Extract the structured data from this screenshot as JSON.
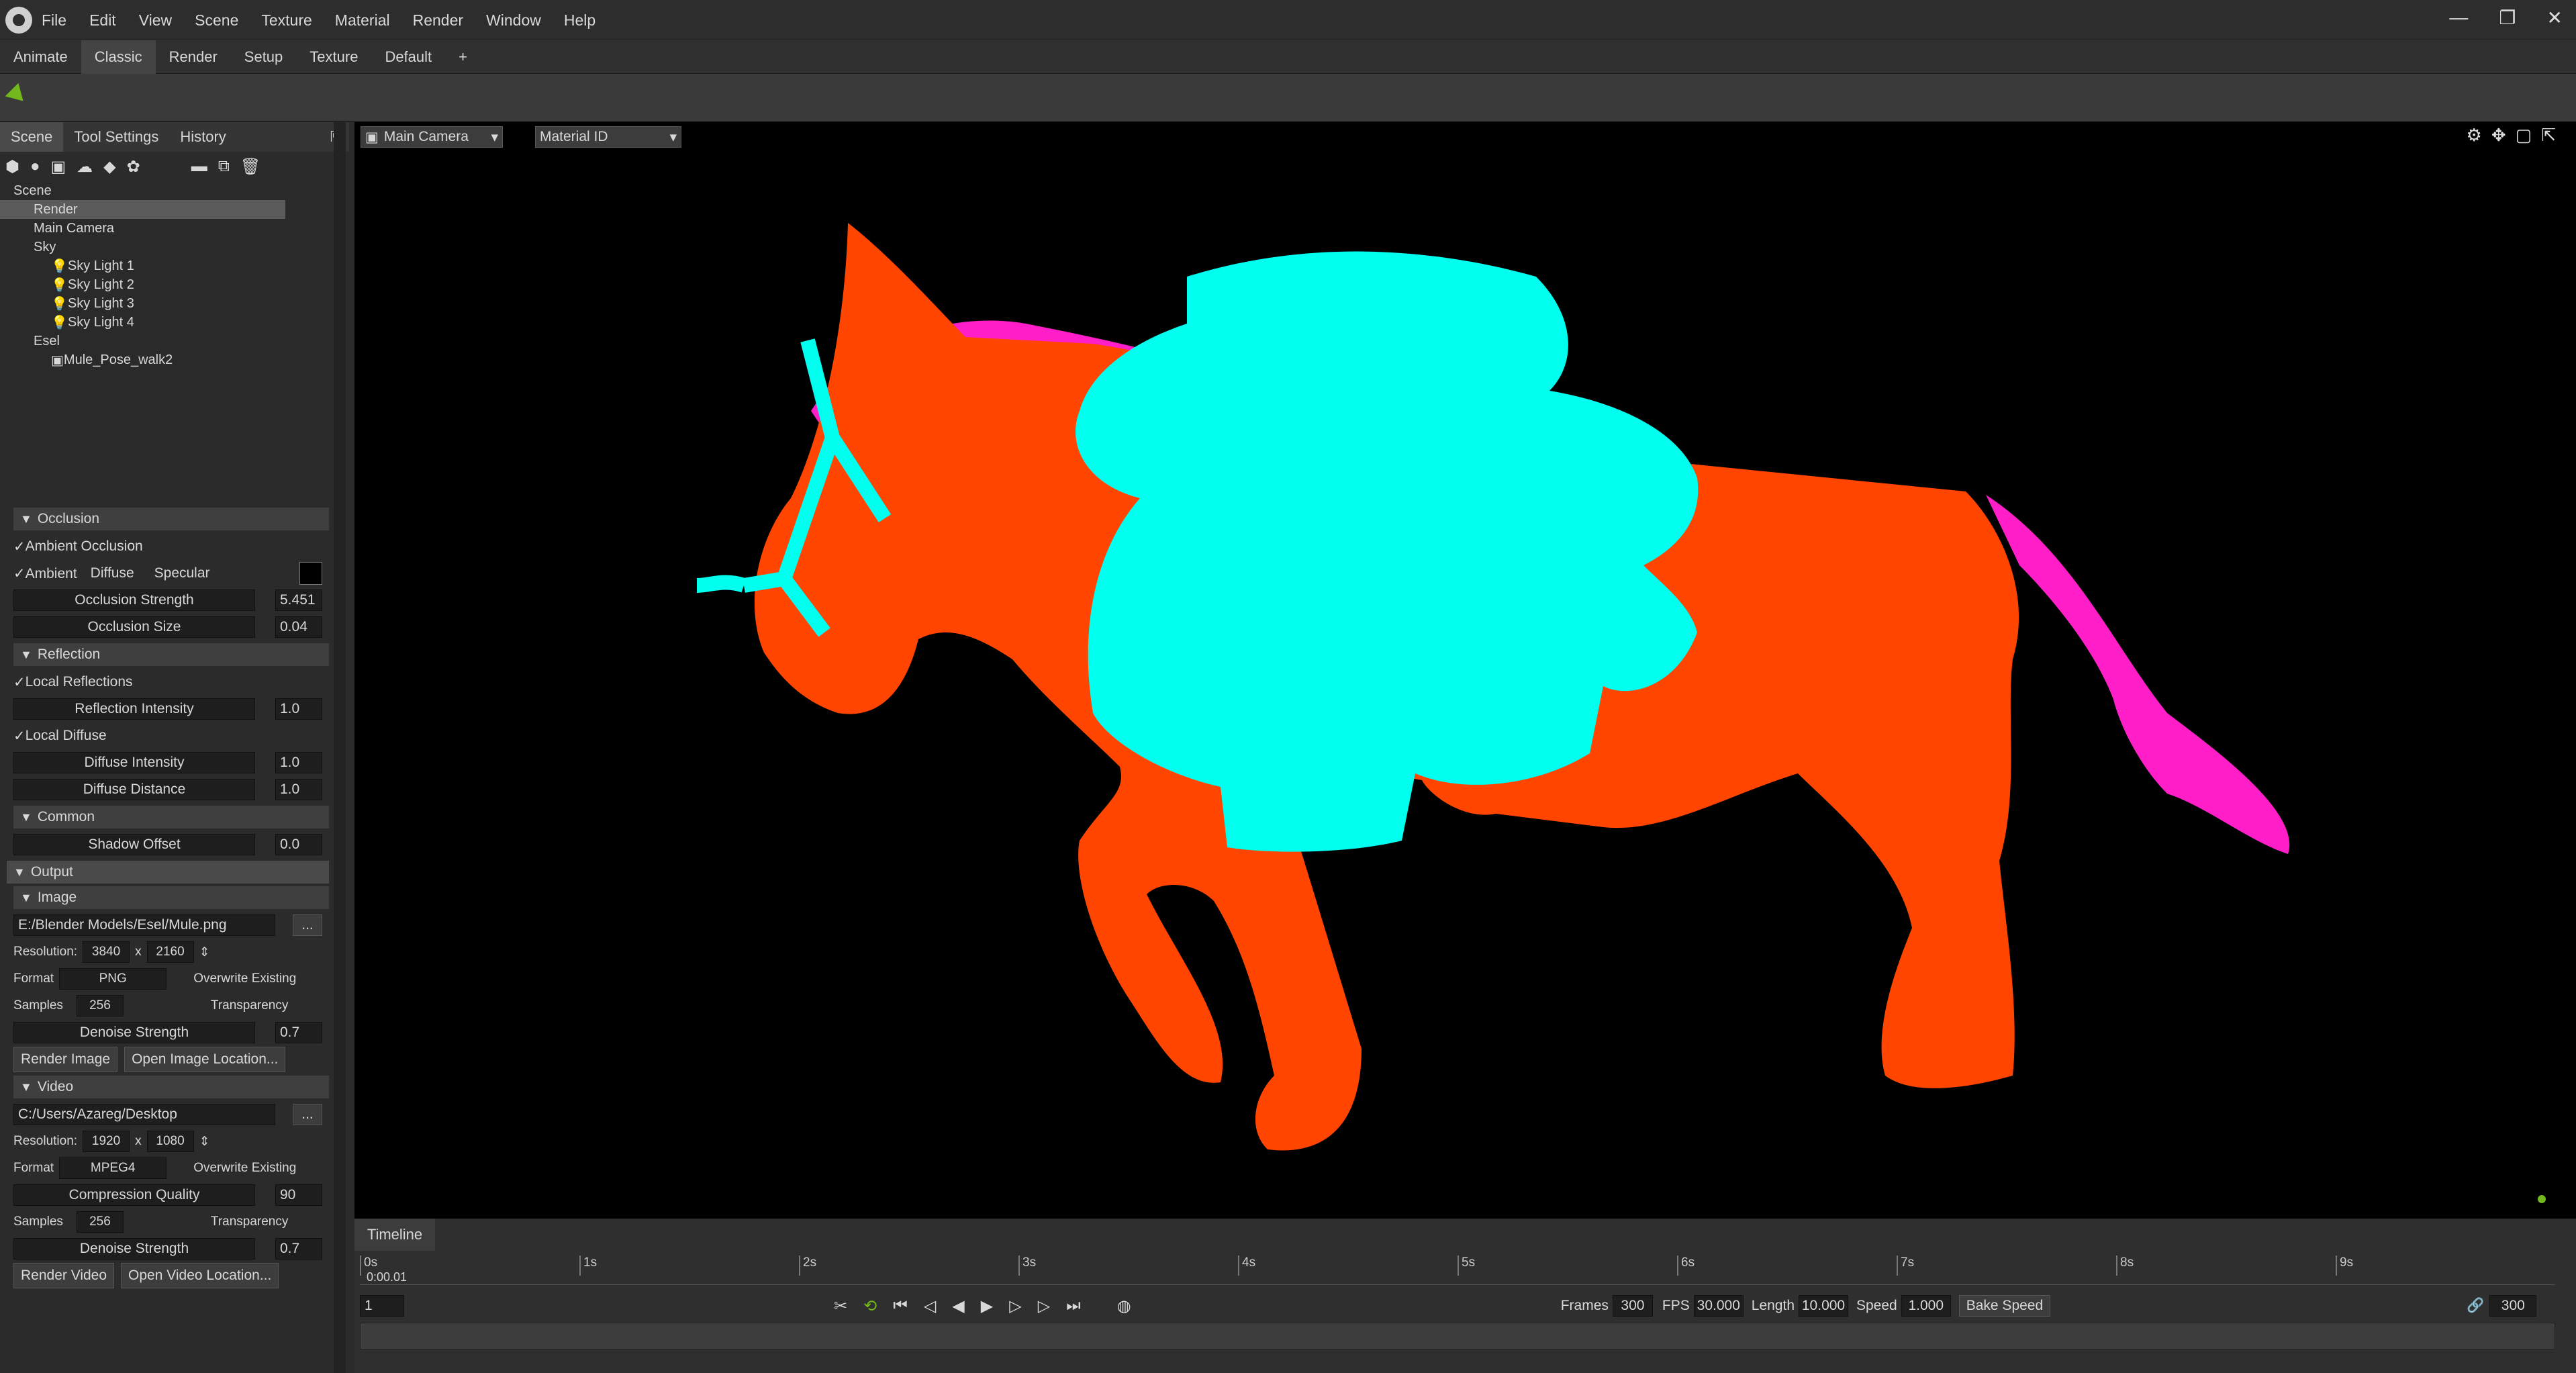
{
  "app": {
    "menus": [
      "File",
      "Edit",
      "View",
      "Scene",
      "Texture",
      "Material",
      "Render",
      "Window",
      "Help"
    ]
  },
  "workspaces": {
    "tabs": [
      "Animate",
      "Classic",
      "Render",
      "Setup",
      "Texture",
      "Default",
      "+"
    ],
    "active": "Classic"
  },
  "left": {
    "tabs": [
      "Scene",
      "Tool Settings",
      "History"
    ],
    "tree": [
      {
        "label": "Scene",
        "indent": 0
      },
      {
        "label": "Render",
        "indent": 1,
        "selected": true
      },
      {
        "label": "Main Camera",
        "indent": 1
      },
      {
        "label": "Sky",
        "indent": 1
      },
      {
        "label": "Sky Light 1",
        "indent": 2
      },
      {
        "label": "Sky Light 2",
        "indent": 2
      },
      {
        "label": "Sky Light 3",
        "indent": 2
      },
      {
        "label": "Sky Light 4",
        "indent": 2
      },
      {
        "label": "Esel",
        "indent": 1
      },
      {
        "label": "Mule_Pose_walk2",
        "indent": 2
      }
    ],
    "occlusion": {
      "header": "Occlusion",
      "ambient_occlusion": "Ambient Occlusion",
      "ambient": "Ambient",
      "diffuse": "Diffuse",
      "specular": "Specular",
      "strength_label": "Occlusion Strength",
      "strength": "5.451",
      "size_label": "Occlusion Size",
      "size": "0.04"
    },
    "reflection": {
      "header": "Reflection",
      "local_reflections": "Local Reflections",
      "refl_label": "Reflection Intensity",
      "refl": "1.0",
      "local_diffuse": "Local Diffuse",
      "diff_label": "Diffuse Intensity",
      "diff": "1.0",
      "dist_label": "Diffuse Distance",
      "dist": "1.0"
    },
    "common": {
      "header": "Common",
      "shadow_label": "Shadow Offset",
      "shadow": "0.0"
    },
    "output": {
      "header": "Output"
    },
    "image": {
      "header": "Image",
      "path": "E:/Blender Models/Esel/Mule.png",
      "res_label": "Resolution:",
      "w": "3840",
      "x": "x",
      "h": "2160",
      "format_label": "Format",
      "format": "PNG",
      "overwrite": "Overwrite Existing",
      "samples_label": "Samples",
      "samples": "256",
      "transparency": "Transparency",
      "denoise_label": "Denoise Strength",
      "denoise": "0.7",
      "render": "Render Image",
      "open": "Open Image Location..."
    },
    "video": {
      "header": "Video",
      "path": "C:/Users/Azareg/Desktop",
      "res_label": "Resolution:",
      "w": "1920",
      "x": "x",
      "h": "1080",
      "format_label": "Format",
      "format": "MPEG4",
      "overwrite": "Overwrite Existing",
      "quality_label": "Compression Quality",
      "quality": "90",
      "samples_label": "Samples",
      "samples": "256",
      "transparency": "Transparency",
      "denoise_label": "Denoise Strength",
      "denoise": "0.7",
      "render": "Render Video",
      "open": "Open Video Location..."
    }
  },
  "viewport": {
    "camera": "Main Camera",
    "mode": "Material ID"
  },
  "timeline": {
    "tab": "Timeline",
    "ticks": [
      "0s",
      "1s",
      "2s",
      "3s",
      "4s",
      "5s",
      "6s",
      "7s",
      "8s",
      "9s"
    ],
    "current_time": "0:00.01",
    "frame": "1",
    "frames_label": "Frames",
    "frames": "300",
    "fps_label": "FPS",
    "fps": "30.000",
    "length_label": "Length",
    "length": "10.000",
    "speed_label": "Speed",
    "speed": "1.000",
    "bake": "Bake Speed",
    "end_frame": "300"
  },
  "colors": {
    "body": "#ff4500",
    "pack": "#00ffee",
    "mane": "#ff1ec8",
    "accent": "#73b81c"
  }
}
